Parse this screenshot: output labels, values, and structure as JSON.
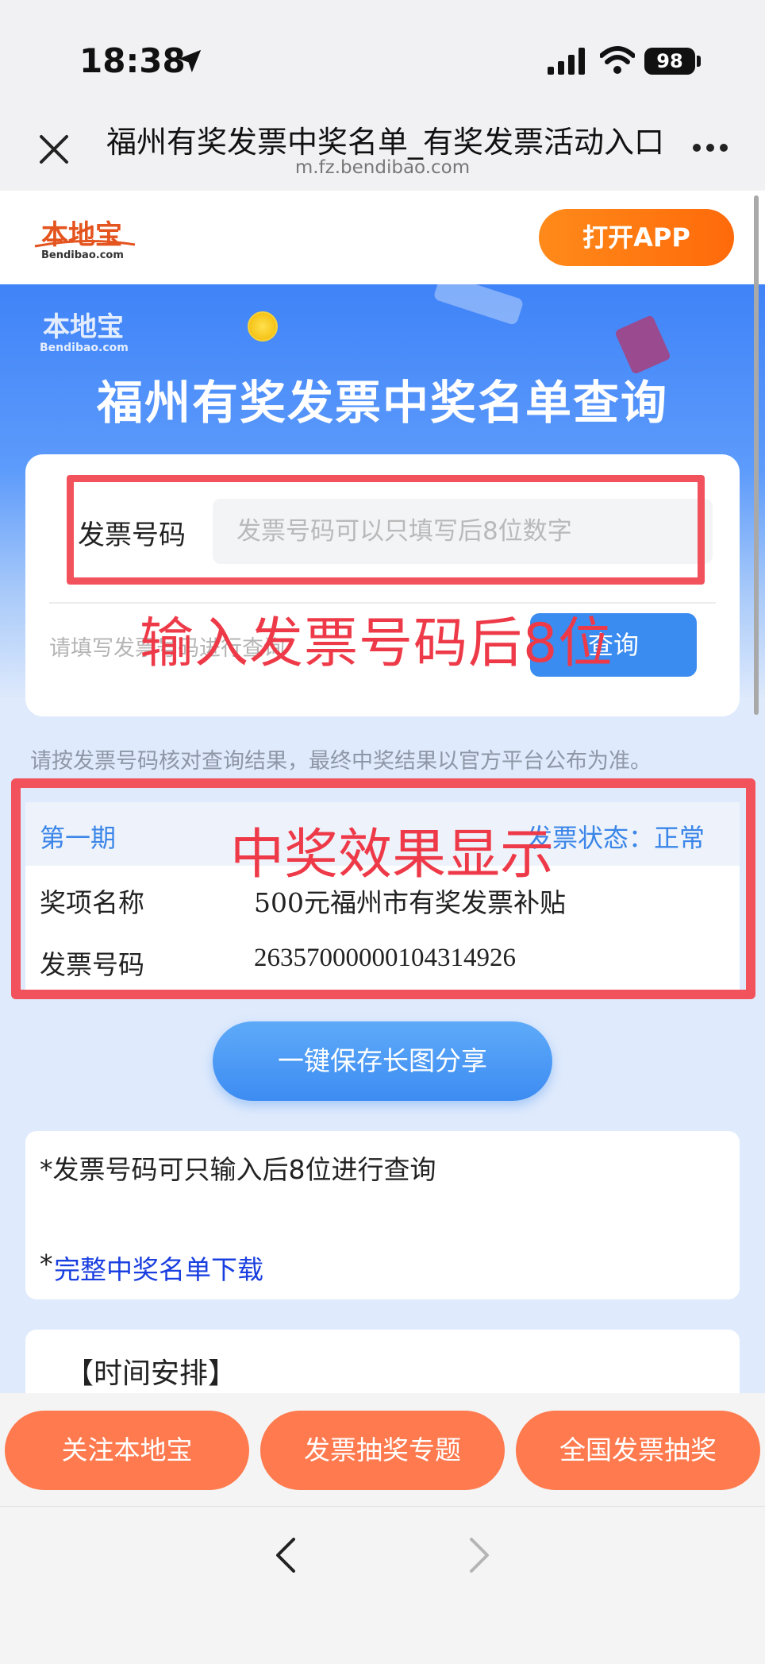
{
  "status_bar": {
    "time": "18:38",
    "battery": "98"
  },
  "browser": {
    "title": "福州有奖发票中奖名单_有奖发票活动入口",
    "url": "m.fz.bendibao.com"
  },
  "site_header": {
    "logo_cn": "本地宝",
    "logo_en": "Bendibao.com",
    "open_app_label": "打开APP"
  },
  "banner": {
    "logo_cn": "本地宝",
    "logo_en": "Bendibao.com",
    "title": "福州有奖发票中奖名单查询"
  },
  "query": {
    "invoice_label": "发票号码",
    "invoice_placeholder": "发票号码可以只填写后8位数字",
    "hint": "请填写发票号码进行查询",
    "button_label": "查询",
    "annotation": "输入发票号码后8位"
  },
  "note": "请按发票号码核对查询结果，最终中奖结果以官方平台公布为准。",
  "result": {
    "period": "第一期",
    "status": "发票状态：正常",
    "rows": [
      {
        "label": "奖项名称",
        "value": "500元福州市有奖发票补贴"
      },
      {
        "label": "发票号码",
        "value": "2635700000010431492​6"
      }
    ],
    "annotation": "中奖效果显示"
  },
  "share_button": "一键保存长图分享",
  "info": {
    "line1": "*发票号码可只输入后8位进行查询",
    "line2_prefix": "*",
    "line2_link": "完整中奖名单下载"
  },
  "time_section": {
    "title": "【时间安排】"
  },
  "action_bar": {
    "buttons": [
      "关注本地宝",
      "发票抽奖专题",
      "全国发票抽奖"
    ]
  },
  "colors": {
    "accent_blue": "#3b8cf0",
    "annotation_red": "#ee3a48",
    "action_orange": "#ff7a4e",
    "app_button_orange": "#ff6a0a"
  }
}
